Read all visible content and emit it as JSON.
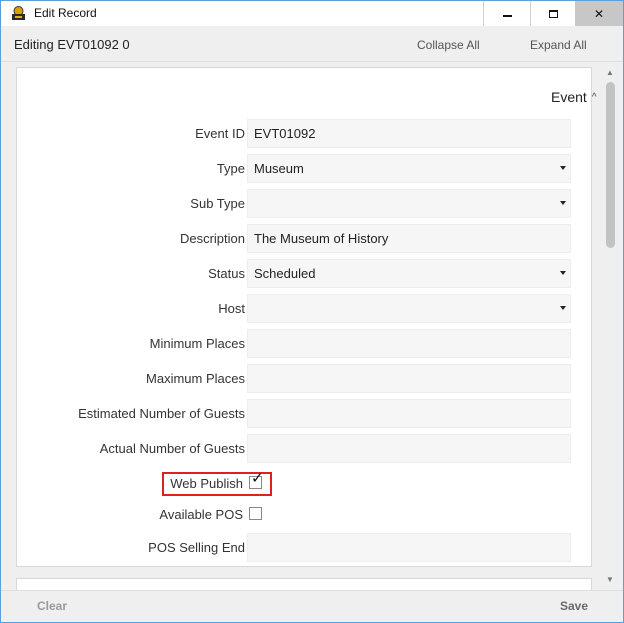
{
  "window": {
    "title": "Edit Record",
    "icon": "app-icon"
  },
  "toolbar": {
    "editing_title": "Editing EVT01092 0",
    "collapse_all": "Collapse All",
    "expand_all": "Expand All"
  },
  "section": {
    "title": "Event"
  },
  "fields": {
    "event_id": {
      "label": "Event ID",
      "value": "EVT01092"
    },
    "type": {
      "label": "Type",
      "value": "Museum"
    },
    "sub_type": {
      "label": "Sub Type",
      "value": ""
    },
    "description": {
      "label": "Description",
      "value": "The Museum of History"
    },
    "status": {
      "label": "Status",
      "value": "Scheduled"
    },
    "host": {
      "label": "Host",
      "value": ""
    },
    "minimum_places": {
      "label": "Minimum Places",
      "value": ""
    },
    "maximum_places": {
      "label": "Maximum Places",
      "value": ""
    },
    "estimated_guests": {
      "label": "Estimated Number of Guests",
      "value": ""
    },
    "actual_guests": {
      "label": "Actual Number of Guests",
      "value": ""
    },
    "web_publish": {
      "label": "Web Publish",
      "checked": true
    },
    "available_pos": {
      "label": "Available POS",
      "checked": false
    },
    "pos_selling_end": {
      "label": "POS Selling End",
      "value": ""
    }
  },
  "footer": {
    "clear": "Clear",
    "save": "Save"
  },
  "colors": {
    "highlight": "#e02020",
    "field_bg": "#f6f6f6",
    "chrome_bg": "#efefef"
  }
}
